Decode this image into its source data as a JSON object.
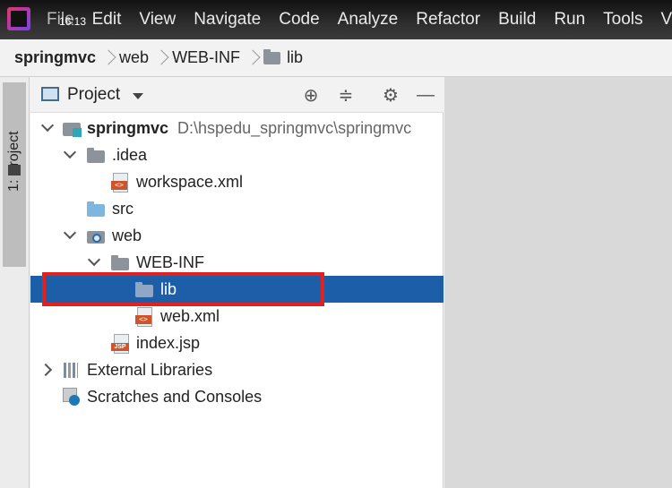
{
  "menubar": {
    "clock": "16:13",
    "items": [
      "File",
      "Edit",
      "View",
      "Navigate",
      "Code",
      "Analyze",
      "Refactor",
      "Build",
      "Run",
      "Tools",
      "VC"
    ]
  },
  "breadcrumb": {
    "items": [
      "springmvc",
      "web",
      "WEB-INF",
      "lib"
    ]
  },
  "toolstrip": {
    "tab_label": "1: Project"
  },
  "panel": {
    "title": "Project",
    "tools": [
      "crosshair-icon",
      "collapse-icon",
      "gear-icon",
      "minimize-icon"
    ]
  },
  "tree": {
    "project": {
      "name": "springmvc",
      "path": "D:\\hspedu_springmvc\\springmvc"
    },
    "idea": ".idea",
    "workspace": "workspace.xml",
    "src": "src",
    "web": "web",
    "webinf": "WEB-INF",
    "lib": "lib",
    "webxml": "web.xml",
    "indexjsp": "index.jsp",
    "extlibs": "External Libraries",
    "scratches": "Scratches and Consoles"
  },
  "colors": {
    "selection": "#1c5fa8",
    "highlight_box": "#e41f1f"
  }
}
